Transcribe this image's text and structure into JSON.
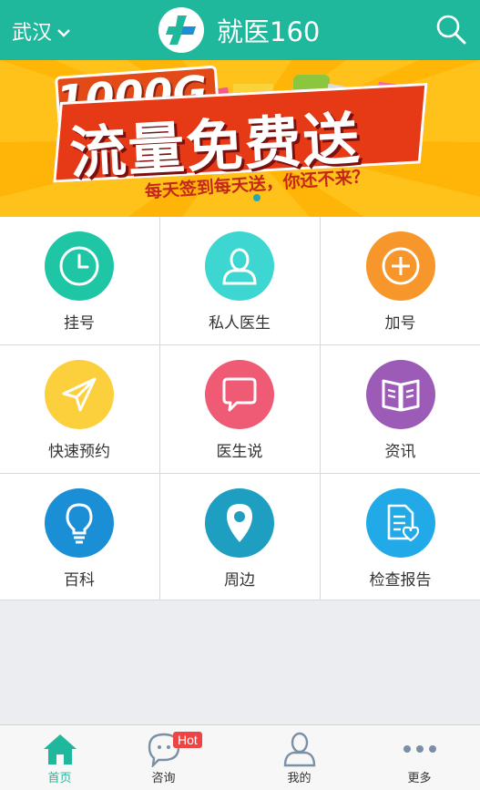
{
  "header": {
    "city": "武汉",
    "app_title": "就医160",
    "bg_color": "#1fb89c"
  },
  "banner": {
    "headline_top": "1000G",
    "headline_main": "流量免费送",
    "subtitle": "每天签到每天送，你还不来？"
  },
  "grid": {
    "items": [
      {
        "label": "挂号",
        "icon": "clock-icon",
        "color": "#1fc6a6"
      },
      {
        "label": "私人医生",
        "icon": "doctor-person-icon",
        "color": "#3ed6d0"
      },
      {
        "label": "加号",
        "icon": "plus-circle-icon",
        "color": "#f7962a"
      },
      {
        "label": "快速预约",
        "icon": "paper-plane-icon",
        "color": "#fbd03c"
      },
      {
        "label": "医生说",
        "icon": "speech-bubble-icon",
        "color": "#ef5a75"
      },
      {
        "label": "资讯",
        "icon": "open-book-icon",
        "color": "#9c5bb6"
      },
      {
        "label": "百科",
        "icon": "lightbulb-icon",
        "color": "#1a8fd6"
      },
      {
        "label": "周边",
        "icon": "map-pin-icon",
        "color": "#1e9ec0"
      },
      {
        "label": "检查报告",
        "icon": "report-heart-icon",
        "color": "#21a9e8"
      }
    ]
  },
  "tabbar": {
    "tabs": [
      {
        "label": "首页",
        "icon": "home-icon",
        "active": true
      },
      {
        "label": "咨询",
        "icon": "chat-bubble-icon",
        "badge": "Hot"
      },
      {
        "label": "我的",
        "icon": "user-icon"
      },
      {
        "label": "更多",
        "icon": "more-dots-icon"
      }
    ],
    "accent": "#1fb89c"
  }
}
